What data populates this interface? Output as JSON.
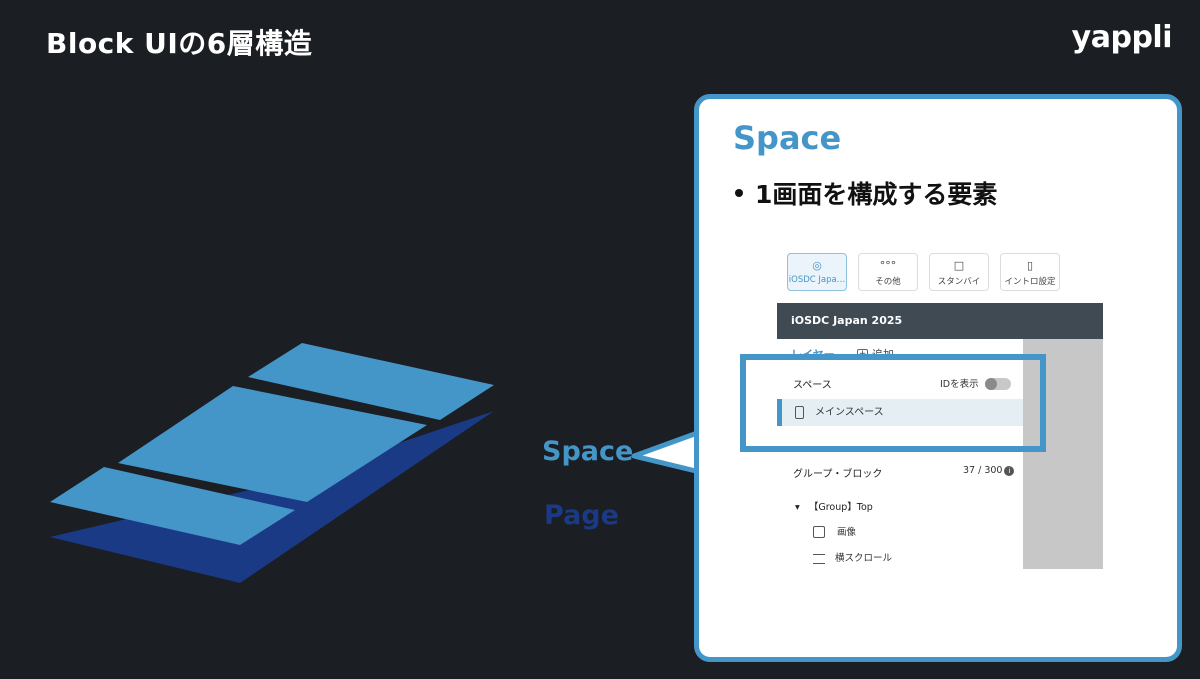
{
  "slide": {
    "title": "Block UIの6層構造",
    "logo_text": "yappli"
  },
  "stack_labels": {
    "space": "Space",
    "page": "Page"
  },
  "panel": {
    "heading": "Space",
    "bullet": "1画面を構成する要素"
  },
  "app": {
    "tabs": [
      {
        "label": "iOSDC Japa…",
        "icon": "globe-icon",
        "active": true
      },
      {
        "label": "その他",
        "icon": "more-dots-icon",
        "active": false
      },
      {
        "label": "スタンバイ",
        "icon": "standby-window-icon",
        "active": false
      },
      {
        "label": "イントロ設定",
        "icon": "intro-phone-icon",
        "active": false
      }
    ],
    "header_title": "iOSDC Japan 2025",
    "layer_tab": "レイヤー",
    "add_label": "追加",
    "space_section_label": "スペース",
    "id_toggle_label": "IDを表示",
    "main_space": "メインスペース",
    "group_section_label": "グループ・ブロック",
    "group_count": "37 / 300",
    "tree": {
      "group": "【Group】Top",
      "items": [
        "画像",
        "横スクロール"
      ]
    }
  },
  "colors": {
    "background": "#1b1e22",
    "accent_blue": "#4596c8",
    "page_navy": "#1a3a86",
    "app_header": "#404a52"
  }
}
